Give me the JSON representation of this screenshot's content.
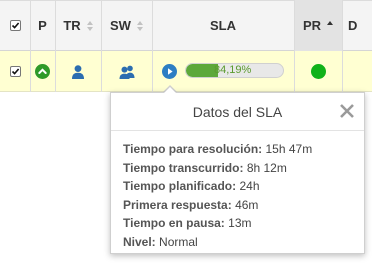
{
  "headers": {
    "p": "P",
    "tr": "TR",
    "sw": "SW",
    "sla": "SLA",
    "pr": "PR",
    "d": "D"
  },
  "row": {
    "sla_percent_label": "84,19%",
    "sla_progress": 0.8419,
    "priority_color": "#10b21a",
    "status_color": "#2f9a29",
    "play_color": "#2d7ec3",
    "icons": {
      "status": "chevron-up-icon",
      "tr": "user-icon",
      "sw": "users-icon",
      "sla": "play-icon"
    }
  },
  "popover": {
    "title": "Datos del SLA",
    "close_icon": "close-icon",
    "fields": [
      {
        "label": "Tiempo para resolución:",
        "value": "15h 47m"
      },
      {
        "label": "Tiempo transcurrido:",
        "value": "8h 12m"
      },
      {
        "label": "Tiempo planificado:",
        "value": "24h"
      },
      {
        "label": "Primera respuesta:",
        "value": "46m"
      },
      {
        "label": "Tiempo en pausa:",
        "value": "13m"
      },
      {
        "label": "Nivel:",
        "value": "Normal"
      }
    ]
  },
  "colors": {
    "row_highlight": "#ffffd2",
    "header_bg": "#f4f4f4",
    "sorted_header_bg": "#e3e3e3"
  }
}
